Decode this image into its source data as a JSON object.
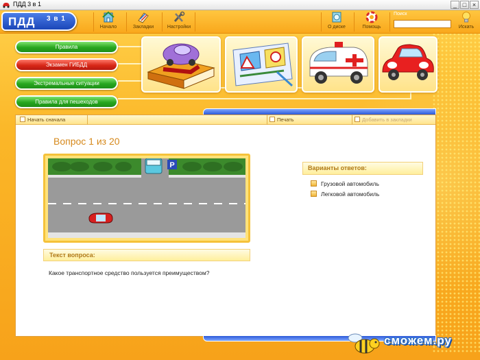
{
  "window": {
    "title": "ПДД 3 в 1"
  },
  "logo": {
    "main": "ПДД",
    "sub": "3 в 1"
  },
  "toolbar": {
    "home": "Начало",
    "bookmarks": "Закладки",
    "settings": "Настройки",
    "about": "О диске",
    "help": "Помощь",
    "search_label": "Поиск",
    "search_button": "Искать",
    "search_value": ""
  },
  "nav": [
    "Правила",
    "Экзамен ГИБДД",
    "Экстремальные ситуации",
    "Правила для пешеходов"
  ],
  "strip": {
    "restart": "Начать сначала",
    "print": "Печать",
    "add_bookmark": "Добавить в закладки"
  },
  "question": {
    "title": "Вопрос 1 из 20",
    "text_header": "Текст вопроса:",
    "text": "Какое транспортное средство пользуется преимуществом?",
    "parking_sign": "P"
  },
  "answers": {
    "header": "Варианты ответов:",
    "options": [
      "Грузовой автомобиль",
      "Легковой автомобиль"
    ]
  },
  "watermark": "сможем.ру",
  "colors": {
    "accent_orange": "#f7a21a",
    "nav_green": "#27a61f",
    "nav_red": "#d82818",
    "logo_blue": "#1b46b8"
  }
}
